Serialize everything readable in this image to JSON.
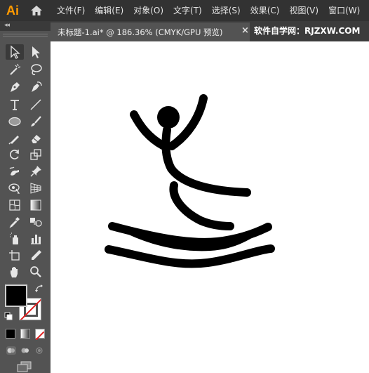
{
  "app": {
    "logo": "Ai",
    "menus": [
      "文件(F)",
      "编辑(E)",
      "对象(O)",
      "文字(T)",
      "选择(S)",
      "效果(C)",
      "视图(V)",
      "窗口(W)"
    ]
  },
  "document": {
    "tab_label": "未标题-1.ai* @ 186.36% (CMYK/GPU 预览)",
    "close_glyph": "×",
    "watermark": "软件自学网：RJZXW.COM"
  },
  "toolbar": {
    "collapse_glyph": "◂◂",
    "tools": [
      "selection-tool",
      "direct-selection-tool",
      "magic-wand-tool",
      "lasso-tool",
      "pen-tool",
      "curvature-tool",
      "type-tool",
      "line-segment-tool",
      "ellipse-tool",
      "paintbrush-tool",
      "shaper-tool",
      "eraser-tool",
      "rotate-tool",
      "scale-tool",
      "warp-tool",
      "puppet-warp-tool",
      "shape-builder-tool",
      "perspective-grid-tool",
      "mesh-tool",
      "gradient-tool",
      "eyedropper-tool",
      "blend-tool",
      "symbol-sprayer-tool",
      "column-graph-tool",
      "artboard-tool",
      "slice-tool",
      "hand-tool",
      "zoom-tool"
    ],
    "selected_tool": "selection-tool",
    "fill_color": "#000000",
    "stroke_color": "none"
  },
  "colors": {
    "menubar_bg": "#323232",
    "panel_bg": "#535353",
    "canvas_bg": "#ffffff",
    "logo_color": "#ff9a00",
    "artwork": "#000000"
  }
}
